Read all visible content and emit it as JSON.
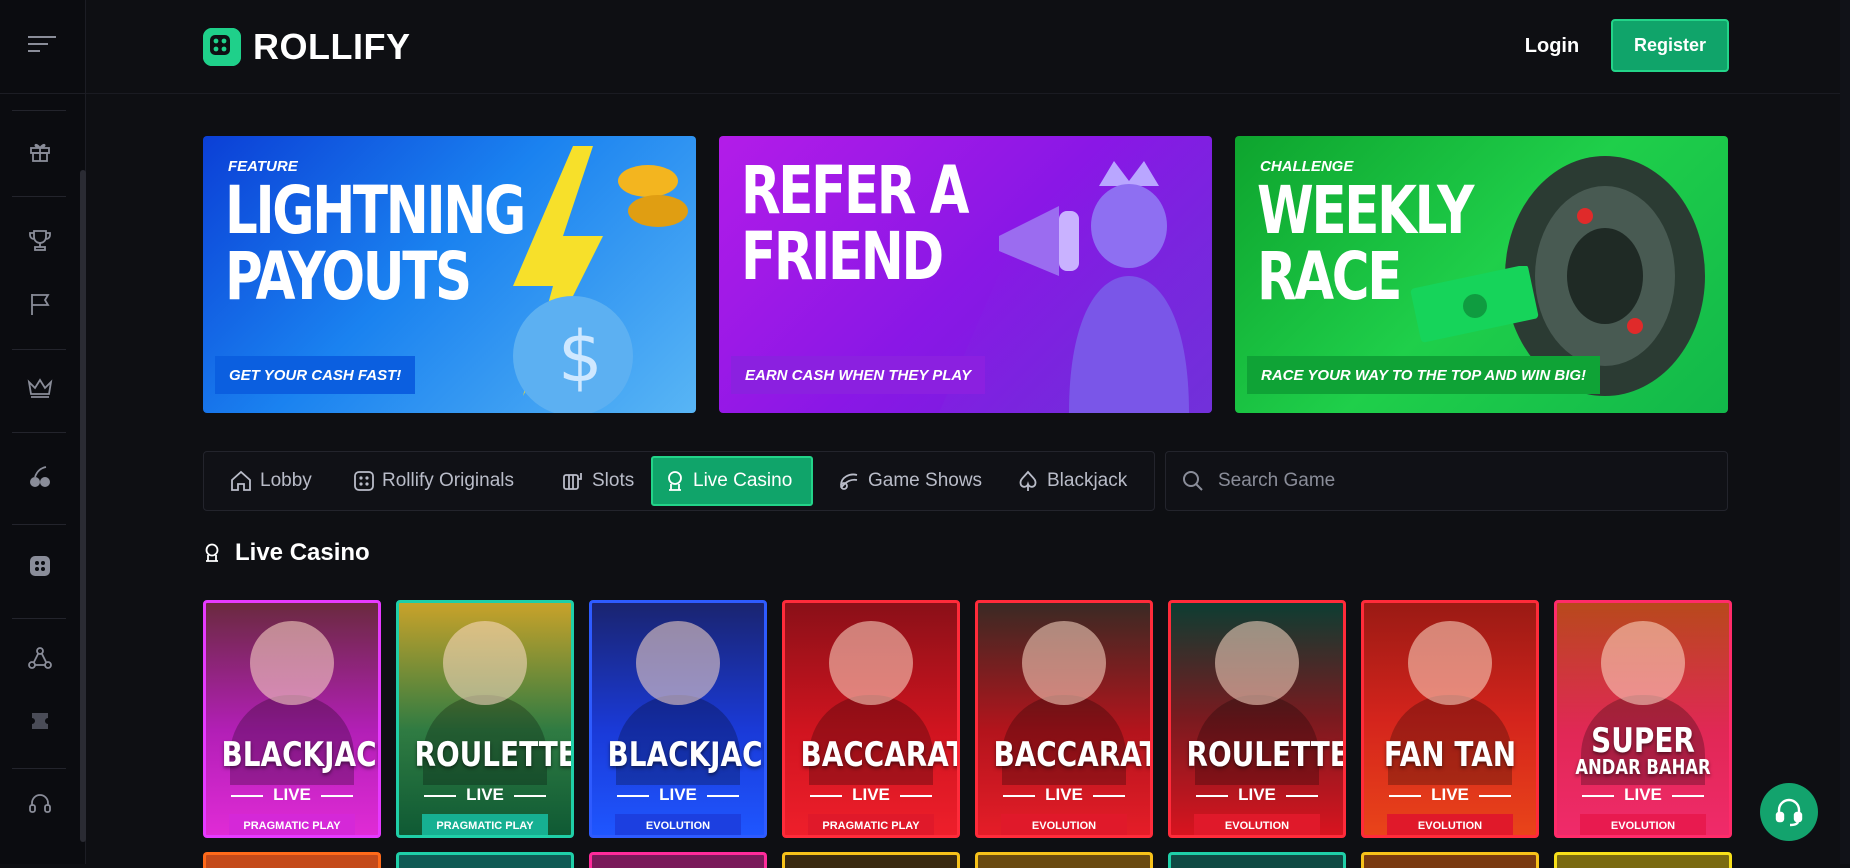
{
  "brand": {
    "name": "ROLLIFY",
    "accent": "#10a46a"
  },
  "header": {
    "login": "Login",
    "register": "Register"
  },
  "sidebar": {
    "items": [
      "menu-icon",
      "gift-icon",
      "trophy-icon",
      "flag-icon",
      "crown-icon",
      "cherry-icon",
      "originals-icon",
      "network-icon",
      "ticket-icon",
      "support-icon"
    ]
  },
  "banners": [
    {
      "kicker": "FEATURE",
      "title_1": "LIGHTNING",
      "title_2": "PAYOUTS",
      "strip": "GET YOUR CASH FAST!"
    },
    {
      "kicker": "",
      "title_1": "REFER A",
      "title_2": "FRIEND",
      "strip": "EARN CASH WHEN THEY PLAY"
    },
    {
      "kicker": "CHALLENGE",
      "title_1": "WEEKLY",
      "title_2": "RACE",
      "strip": "RACE YOUR WAY TO THE TOP AND WIN BIG!"
    }
  ],
  "tabs": [
    "Lobby",
    "Rollify Originals",
    "Slots",
    "Live Casino",
    "Game Shows",
    "Blackjack"
  ],
  "active_tab": "Live Casino",
  "search": {
    "placeholder": "Search Game"
  },
  "section": {
    "title": "Live Casino"
  },
  "games": [
    {
      "title": "BLACKJACK",
      "sub": "",
      "live": "LIVE",
      "provider": "PRAGMATIC PLAY"
    },
    {
      "title": "ROULETTE",
      "sub": "",
      "live": "LIVE",
      "provider": "PRAGMATIC PLAY"
    },
    {
      "title": "BLACKJACK",
      "sub": "",
      "live": "LIVE",
      "provider": "EVOLUTION"
    },
    {
      "title": "BACCARAT",
      "sub": "",
      "live": "LIVE",
      "provider": "PRAGMATIC PLAY"
    },
    {
      "title": "BACCARAT",
      "sub": "",
      "live": "LIVE",
      "provider": "EVOLUTION"
    },
    {
      "title": "ROULETTE",
      "sub": "",
      "live": "LIVE",
      "provider": "EVOLUTION"
    },
    {
      "title": "FAN TAN",
      "sub": "",
      "live": "LIVE",
      "provider": "EVOLUTION"
    },
    {
      "title": "SUPER",
      "sub": "ANDAR BAHAR",
      "live": "LIVE",
      "provider": "EVOLUTION"
    }
  ]
}
